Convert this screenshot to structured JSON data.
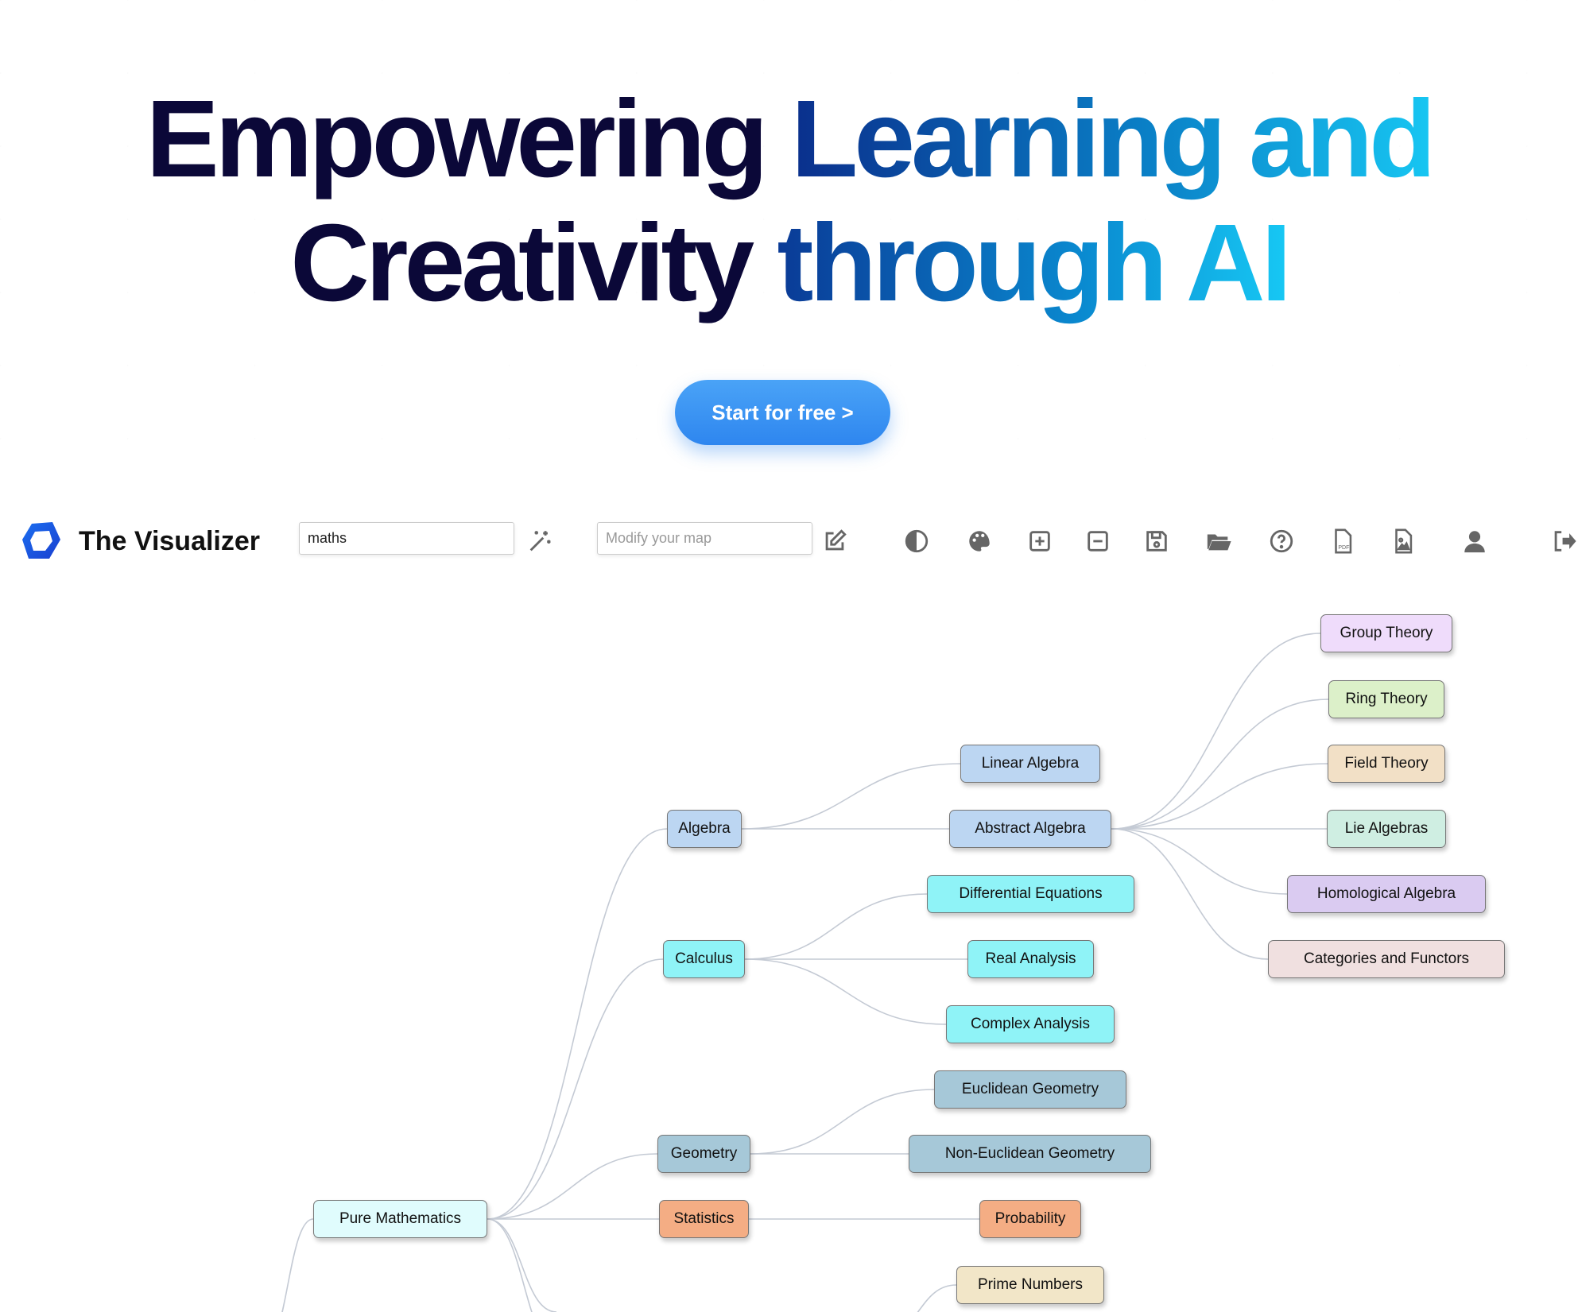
{
  "hero": {
    "line1_dark": "Empowering",
    "line1_accent": "Learning and",
    "line2_dark": "Creativity",
    "line2_accent": "through AI",
    "cta_label": "Start for free >"
  },
  "toolbar": {
    "brand": "The Visualizer",
    "topic_input_value": "maths",
    "modify_placeholder": "Modify your map",
    "icons": [
      "magic-wand-icon",
      "edit-icon",
      "contrast-icon",
      "palette-icon",
      "expand-icon",
      "collapse-icon",
      "save-icon",
      "open-folder-icon",
      "help-icon",
      "pdf-export-icon",
      "image-export-icon",
      "user-icon",
      "logout-icon"
    ],
    "accent_color": "#2e86ef"
  },
  "mindmap": {
    "nodes": [
      {
        "label": "Pure Mathematics",
        "color": "#e0fcfd",
        "parent": null
      },
      {
        "label": "Algebra",
        "color": "#bcd6f2",
        "parent": "Pure Mathematics"
      },
      {
        "label": "Calculus",
        "color": "#8ff3f7",
        "parent": "Pure Mathematics"
      },
      {
        "label": "Geometry",
        "color": "#a6c8d8",
        "parent": "Pure Mathematics"
      },
      {
        "label": "Statistics",
        "color": "#f4ad84",
        "parent": "Pure Mathematics"
      },
      {
        "label": "Linear Algebra",
        "color": "#bcd6f2",
        "parent": "Algebra"
      },
      {
        "label": "Abstract Algebra",
        "color": "#bcd6f2",
        "parent": "Algebra"
      },
      {
        "label": "Differential Equations",
        "color": "#8ff3f7",
        "parent": "Calculus"
      },
      {
        "label": "Real Analysis",
        "color": "#8ff3f7",
        "parent": "Calculus"
      },
      {
        "label": "Complex Analysis",
        "color": "#8ff3f7",
        "parent": "Calculus"
      },
      {
        "label": "Euclidean Geometry",
        "color": "#a6c8d8",
        "parent": "Geometry"
      },
      {
        "label": "Non-Euclidean Geometry",
        "color": "#a6c8d8",
        "parent": "Geometry"
      },
      {
        "label": "Probability",
        "color": "#f4ad84",
        "parent": "Statistics"
      },
      {
        "label": "Prime Numbers",
        "color": "#f2e6c8",
        "parent": null
      },
      {
        "label": "Group Theory",
        "color": "#efdcfb",
        "parent": "Abstract Algebra"
      },
      {
        "label": "Ring Theory",
        "color": "#dcf0c9",
        "parent": "Abstract Algebra"
      },
      {
        "label": "Field Theory",
        "color": "#f2e0c6",
        "parent": "Abstract Algebra"
      },
      {
        "label": "Lie Algebras",
        "color": "#cfeee2",
        "parent": "Abstract Algebra"
      },
      {
        "label": "Homological Algebra",
        "color": "#dacbf1",
        "parent": "Abstract Algebra"
      },
      {
        "label": "Categories and Functors",
        "color": "#f0e0e0",
        "parent": "Abstract Algebra"
      }
    ],
    "edge_color": "#c4cad4"
  }
}
